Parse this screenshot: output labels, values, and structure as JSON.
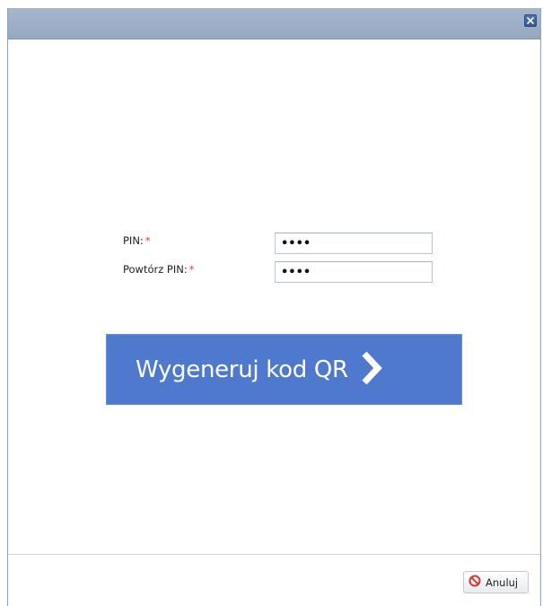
{
  "dialog": {
    "close_icon": "close-icon"
  },
  "form": {
    "pin_label": "PIN:",
    "pin_required_mark": "*",
    "pin_value": "1234",
    "repeat_pin_label": "Powtórz PIN:",
    "repeat_pin_required_mark": "*",
    "repeat_pin_value": "1234"
  },
  "actions": {
    "generate_label": "Wygeneruj kod QR",
    "generate_icon": "chevron-right-icon",
    "generate_color": "#4e79cc",
    "cancel_label": "Anuluj",
    "cancel_icon": "no-entry-icon"
  }
}
